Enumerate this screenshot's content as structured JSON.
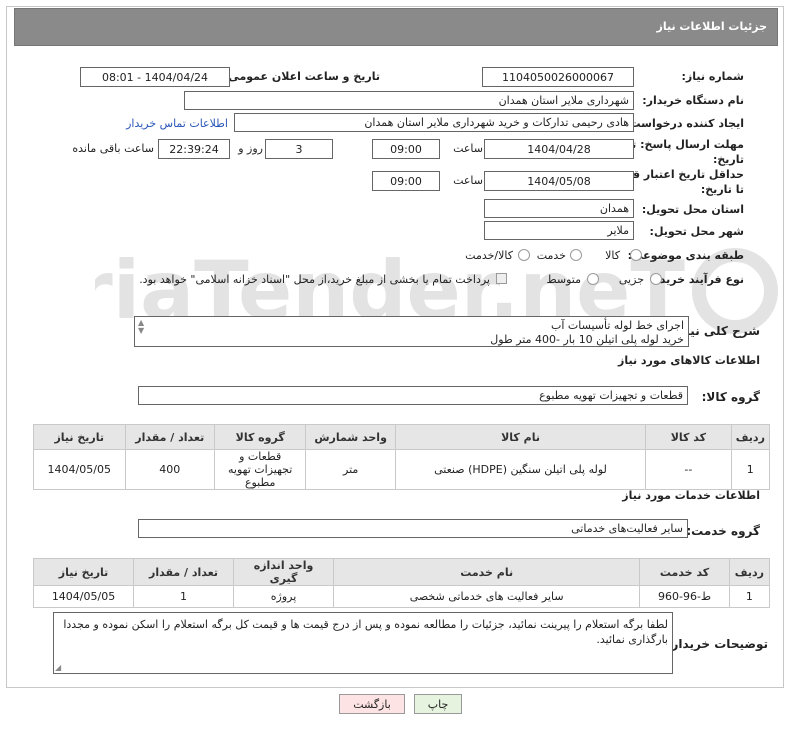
{
  "header": {
    "title": "جزئیات اطلاعات نیاز"
  },
  "need_number": {
    "label": "شماره نیاز:",
    "value": "1104050026000067"
  },
  "announce": {
    "label": "تاریخ و ساعت اعلان عمومی:",
    "value": "1404/04/24 - 08:01"
  },
  "buyer_org": {
    "label": "نام دستگاه خریدار:",
    "value": "شهرداری ملایر استان همدان"
  },
  "requester": {
    "label": "ایجاد کننده درخواست:",
    "value": "هادی رحیمی تدارکات و خرید شهرداری ملایر استان همدان",
    "contact_link": "اطلاعات تماس خریدار"
  },
  "deadline": {
    "label": "مهلت ارسال پاسخ: تا تاریخ:",
    "date": "1404/04/28",
    "time_label": "ساعت",
    "time": "09:00",
    "days": "3",
    "days_label": "روز و",
    "remaining": "22:39:24",
    "remaining_label": "ساعت باقی مانده"
  },
  "min_validity": {
    "label": "حداقل تاریخ اعتبار قیمت: تا تاریخ:",
    "date": "1404/05/08",
    "time_label": "ساعت",
    "time": "09:00"
  },
  "province": {
    "label": "استان محل تحویل:",
    "value": "همدان"
  },
  "city": {
    "label": "شهر محل تحویل:",
    "value": "ملایر"
  },
  "category": {
    "label": "طبقه بندی موضوعی:",
    "options": [
      "کالا",
      "خدمت",
      "کالا/خدمت"
    ]
  },
  "process": {
    "label": "نوع فرآیند خرید :",
    "options": [
      "جزیی",
      "متوسط"
    ],
    "note": "پرداخت تمام یا بخشی از مبلغ خرید،از محل \"اسناد خزانه اسلامی\" خواهد بود."
  },
  "summary": {
    "label": "شرح کلی نیاز:",
    "line1": "اجرای خط لوله تأسیسات آب",
    "line2": "خرید لوله پلی اتیلن 10 بار -400 متر طول"
  },
  "goods": {
    "section_title": "اطلاعات کالاهای مورد نیاز",
    "group_label": "گروه کالا:",
    "group_value": "قطعات و تجهیزات تهویه مطبوع",
    "columns": [
      "ردیف",
      "کد کالا",
      "نام کالا",
      "واحد شمارش",
      "گروه کالا",
      "تعداد / مقدار",
      "تاریخ نیاز"
    ],
    "rows": [
      {
        "row": "1",
        "code": "--",
        "name": "لوله پلی اتیلن سنگین (HDPE) صنعتی",
        "unit": "متر",
        "group": "قطعات و تجهیزات تهویه مطبوع",
        "qty": "400",
        "date": "1404/05/05"
      }
    ]
  },
  "services": {
    "section_title": "اطلاعات خدمات مورد نیاز",
    "group_label": "گروه خدمت:",
    "group_value": "سایر فعالیت‌های خدماتی",
    "columns": [
      "ردیف",
      "کد خدمت",
      "نام خدمت",
      "واحد اندازه گیری",
      "تعداد / مقدار",
      "تاریخ نیاز"
    ],
    "rows": [
      {
        "row": "1",
        "code": "ط-96-960",
        "name": "سایر فعالیت های خدماتی شخصی",
        "unit": "پروژه",
        "qty": "1",
        "date": "1404/05/05"
      }
    ]
  },
  "buyer_notes": {
    "label": "توضیحات خریدار:",
    "text": "لطفا برگه استعلام را پیرینت نمائید، جزئیات را مطالعه نموده و پس از درج قیمت ها و قیمت کل برگه استعلام را اسکن نموده و مجددا بارگذاری نمائید."
  },
  "buttons": {
    "print": "چاپ",
    "back": "بازگشت"
  },
  "watermark": "AriaTender.neT",
  "colors": {
    "title_bar": "#8a8a8a",
    "link": "#2a56b8",
    "back_button": "#fde3e3",
    "print_button": "#e6f3df",
    "table_header": "#e6e6e6"
  }
}
